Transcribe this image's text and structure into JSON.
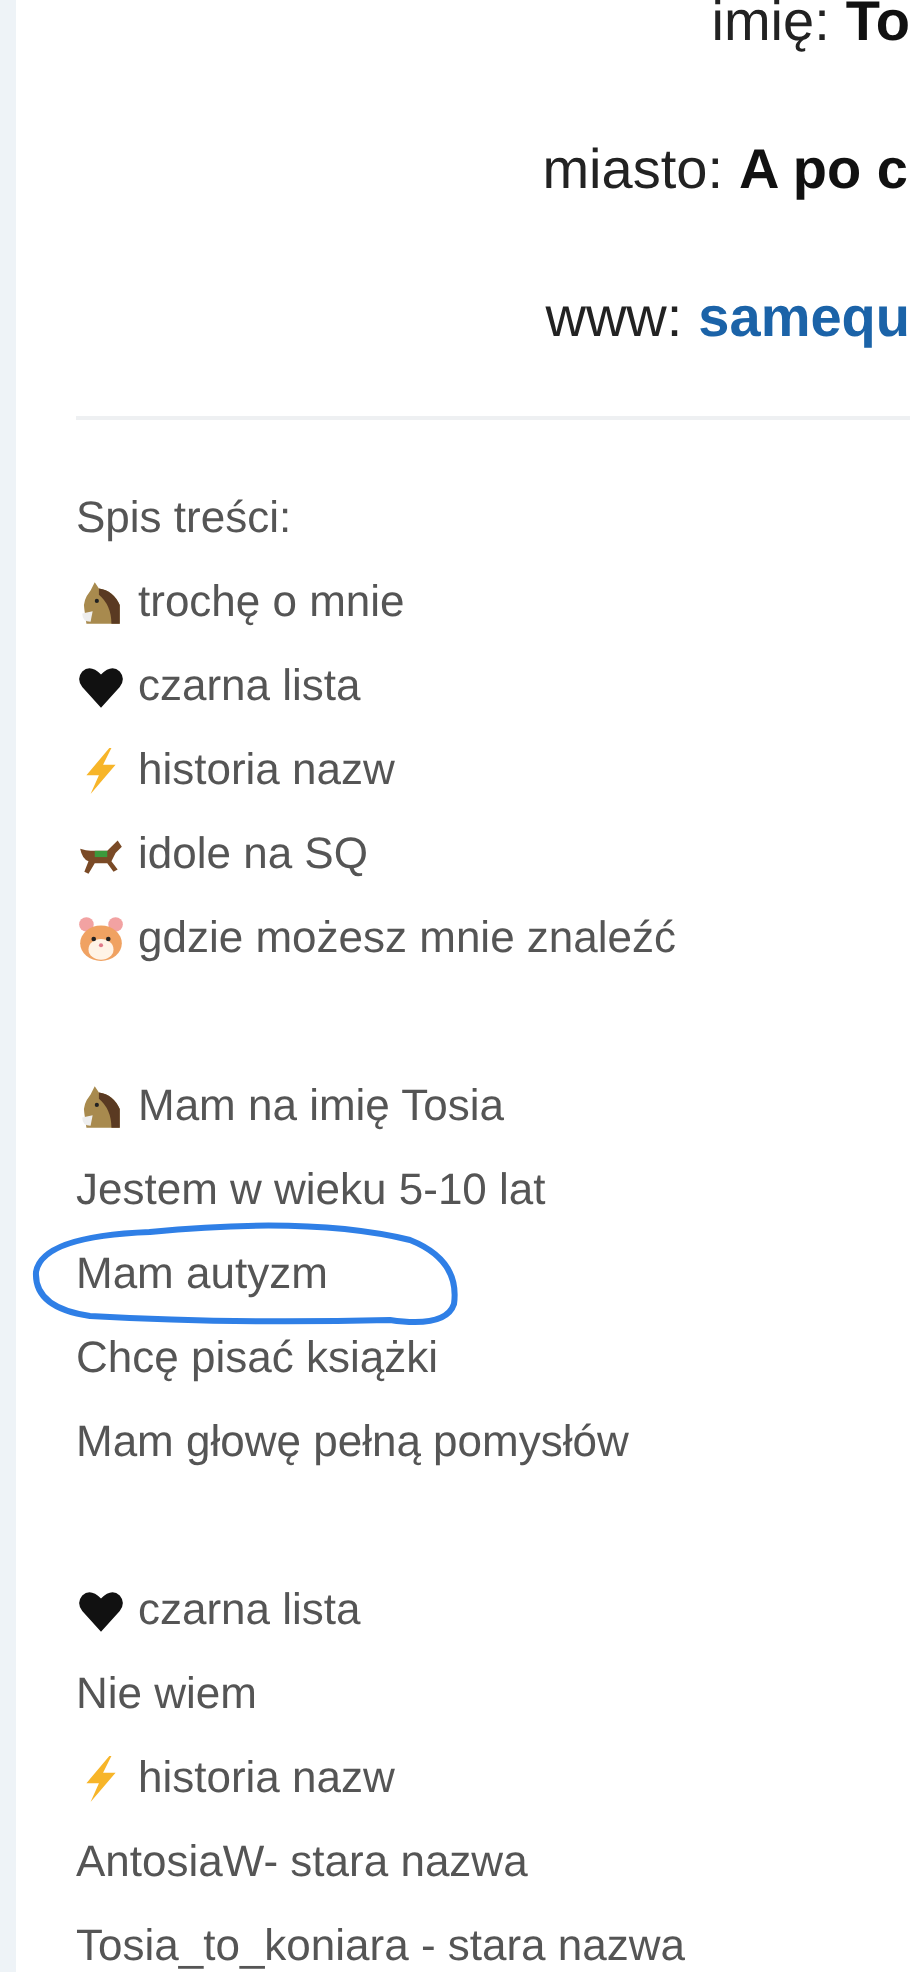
{
  "header": [
    {
      "label": "imię:",
      "value": "To",
      "link": false
    },
    {
      "label": "miasto:",
      "value": "A po c",
      "link": false
    },
    {
      "label": "www:",
      "value": "samequ",
      "link": true
    }
  ],
  "sections": [
    {
      "lines": [
        {
          "kind": "text",
          "text": "Spis treści:"
        },
        {
          "kind": "horse",
          "text": "trochę o mnie"
        },
        {
          "kind": "heart",
          "text": "czarna lista"
        },
        {
          "kind": "bolt",
          "text": "historia nazw"
        },
        {
          "kind": "racehorse",
          "text": "idole na SQ"
        },
        {
          "kind": "hamster",
          "text": "gdzie możesz mnie znaleźć"
        }
      ]
    },
    {
      "lines": [
        {
          "kind": "horse",
          "text": "Mam na imię Tosia"
        },
        {
          "kind": "text",
          "text": "Jestem w wieku 5-10 lat"
        },
        {
          "kind": "text",
          "text": "Mam autyzm",
          "circled": true
        },
        {
          "kind": "text",
          "text": "Chcę pisać książki"
        },
        {
          "kind": "text",
          "text": "Mam głowę pełną pomysłów"
        }
      ]
    },
    {
      "lines": [
        {
          "kind": "heart",
          "text": "czarna lista"
        },
        {
          "kind": "text",
          "text": "Nie wiem"
        },
        {
          "kind": "bolt",
          "text": "historia nazw"
        },
        {
          "kind": "text",
          "text": "AntosiaW- stara nazwa"
        },
        {
          "kind": "text",
          "text": "Tosia_to_koniara - stara nazwa"
        }
      ]
    }
  ]
}
